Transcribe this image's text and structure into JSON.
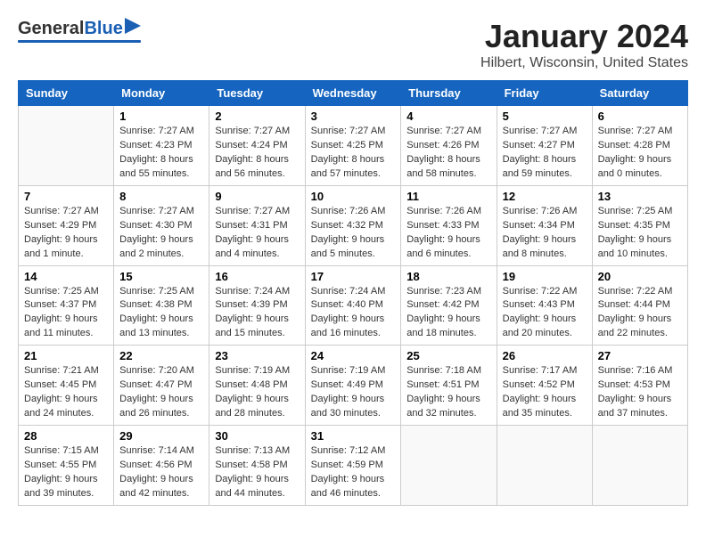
{
  "header": {
    "logo": {
      "general": "General",
      "blue": "Blue",
      "arrow": "▶"
    },
    "title": "January 2024",
    "subtitle": "Hilbert, Wisconsin, United States"
  },
  "calendar": {
    "days_of_week": [
      "Sunday",
      "Monday",
      "Tuesday",
      "Wednesday",
      "Thursday",
      "Friday",
      "Saturday"
    ],
    "weeks": [
      [
        {
          "day": "",
          "info": ""
        },
        {
          "day": "1",
          "info": "Sunrise: 7:27 AM\nSunset: 4:23 PM\nDaylight: 8 hours\nand 55 minutes."
        },
        {
          "day": "2",
          "info": "Sunrise: 7:27 AM\nSunset: 4:24 PM\nDaylight: 8 hours\nand 56 minutes."
        },
        {
          "day": "3",
          "info": "Sunrise: 7:27 AM\nSunset: 4:25 PM\nDaylight: 8 hours\nand 57 minutes."
        },
        {
          "day": "4",
          "info": "Sunrise: 7:27 AM\nSunset: 4:26 PM\nDaylight: 8 hours\nand 58 minutes."
        },
        {
          "day": "5",
          "info": "Sunrise: 7:27 AM\nSunset: 4:27 PM\nDaylight: 8 hours\nand 59 minutes."
        },
        {
          "day": "6",
          "info": "Sunrise: 7:27 AM\nSunset: 4:28 PM\nDaylight: 9 hours\nand 0 minutes."
        }
      ],
      [
        {
          "day": "7",
          "info": "Sunrise: 7:27 AM\nSunset: 4:29 PM\nDaylight: 9 hours\nand 1 minute."
        },
        {
          "day": "8",
          "info": "Sunrise: 7:27 AM\nSunset: 4:30 PM\nDaylight: 9 hours\nand 2 minutes."
        },
        {
          "day": "9",
          "info": "Sunrise: 7:27 AM\nSunset: 4:31 PM\nDaylight: 9 hours\nand 4 minutes."
        },
        {
          "day": "10",
          "info": "Sunrise: 7:26 AM\nSunset: 4:32 PM\nDaylight: 9 hours\nand 5 minutes."
        },
        {
          "day": "11",
          "info": "Sunrise: 7:26 AM\nSunset: 4:33 PM\nDaylight: 9 hours\nand 6 minutes."
        },
        {
          "day": "12",
          "info": "Sunrise: 7:26 AM\nSunset: 4:34 PM\nDaylight: 9 hours\nand 8 minutes."
        },
        {
          "day": "13",
          "info": "Sunrise: 7:25 AM\nSunset: 4:35 PM\nDaylight: 9 hours\nand 10 minutes."
        }
      ],
      [
        {
          "day": "14",
          "info": "Sunrise: 7:25 AM\nSunset: 4:37 PM\nDaylight: 9 hours\nand 11 minutes."
        },
        {
          "day": "15",
          "info": "Sunrise: 7:25 AM\nSunset: 4:38 PM\nDaylight: 9 hours\nand 13 minutes."
        },
        {
          "day": "16",
          "info": "Sunrise: 7:24 AM\nSunset: 4:39 PM\nDaylight: 9 hours\nand 15 minutes."
        },
        {
          "day": "17",
          "info": "Sunrise: 7:24 AM\nSunset: 4:40 PM\nDaylight: 9 hours\nand 16 minutes."
        },
        {
          "day": "18",
          "info": "Sunrise: 7:23 AM\nSunset: 4:42 PM\nDaylight: 9 hours\nand 18 minutes."
        },
        {
          "day": "19",
          "info": "Sunrise: 7:22 AM\nSunset: 4:43 PM\nDaylight: 9 hours\nand 20 minutes."
        },
        {
          "day": "20",
          "info": "Sunrise: 7:22 AM\nSunset: 4:44 PM\nDaylight: 9 hours\nand 22 minutes."
        }
      ],
      [
        {
          "day": "21",
          "info": "Sunrise: 7:21 AM\nSunset: 4:45 PM\nDaylight: 9 hours\nand 24 minutes."
        },
        {
          "day": "22",
          "info": "Sunrise: 7:20 AM\nSunset: 4:47 PM\nDaylight: 9 hours\nand 26 minutes."
        },
        {
          "day": "23",
          "info": "Sunrise: 7:19 AM\nSunset: 4:48 PM\nDaylight: 9 hours\nand 28 minutes."
        },
        {
          "day": "24",
          "info": "Sunrise: 7:19 AM\nSunset: 4:49 PM\nDaylight: 9 hours\nand 30 minutes."
        },
        {
          "day": "25",
          "info": "Sunrise: 7:18 AM\nSunset: 4:51 PM\nDaylight: 9 hours\nand 32 minutes."
        },
        {
          "day": "26",
          "info": "Sunrise: 7:17 AM\nSunset: 4:52 PM\nDaylight: 9 hours\nand 35 minutes."
        },
        {
          "day": "27",
          "info": "Sunrise: 7:16 AM\nSunset: 4:53 PM\nDaylight: 9 hours\nand 37 minutes."
        }
      ],
      [
        {
          "day": "28",
          "info": "Sunrise: 7:15 AM\nSunset: 4:55 PM\nDaylight: 9 hours\nand 39 minutes."
        },
        {
          "day": "29",
          "info": "Sunrise: 7:14 AM\nSunset: 4:56 PM\nDaylight: 9 hours\nand 42 minutes."
        },
        {
          "day": "30",
          "info": "Sunrise: 7:13 AM\nSunset: 4:58 PM\nDaylight: 9 hours\nand 44 minutes."
        },
        {
          "day": "31",
          "info": "Sunrise: 7:12 AM\nSunset: 4:59 PM\nDaylight: 9 hours\nand 46 minutes."
        },
        {
          "day": "",
          "info": ""
        },
        {
          "day": "",
          "info": ""
        },
        {
          "day": "",
          "info": ""
        }
      ]
    ]
  }
}
